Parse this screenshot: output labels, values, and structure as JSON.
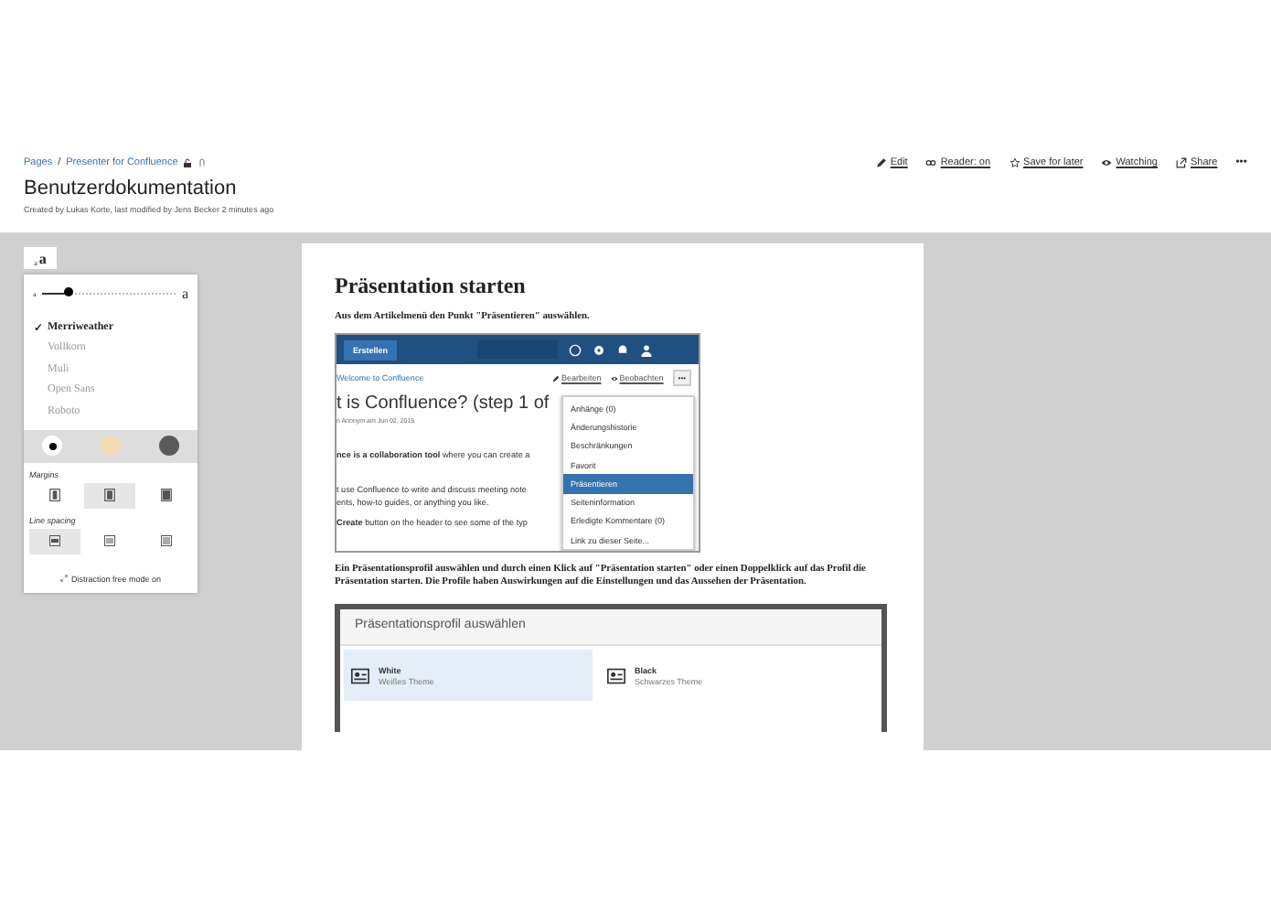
{
  "breadcrumbs": [
    "Pages",
    "Presenter for Confluence"
  ],
  "breadcrumb_separator": "/",
  "more_actions": "•••",
  "page_actions": [
    {
      "kind": "edit",
      "label": "Edit"
    },
    {
      "kind": "reader",
      "label": "Reader: on"
    },
    {
      "kind": "star",
      "label": "Save for later"
    },
    {
      "kind": "eye",
      "label": "Watching"
    },
    {
      "kind": "share",
      "label": "Share"
    }
  ],
  "title": "Benutzerdokumentation",
  "byline": "Created by Lukas Korte, last modified by Jens Becker 2 minutes ago",
  "reader_panel": {
    "size_toggle": [
      "a",
      "a"
    ],
    "size_slider": {
      "min_label": "a",
      "max_label": "a",
      "level": 0.2
    },
    "fonts": [
      {
        "label": "Merriweather",
        "selected": true
      },
      {
        "label": "Vollkorn",
        "selected": false
      },
      {
        "label": "Muli",
        "selected": false
      },
      {
        "label": "Open Sans",
        "selected": false
      },
      {
        "label": "Roboto",
        "selected": false
      }
    ],
    "check_mark": "✓",
    "themes": [
      {
        "color": "#ffffff",
        "selected": true
      },
      {
        "color": "#f0dcb0",
        "selected": false
      },
      {
        "color": "#5a5a5a",
        "selected": false
      }
    ],
    "margins": {
      "label": "Margins",
      "options": [
        {
          "selected": false
        },
        {
          "selected": true
        },
        {
          "selected": false
        }
      ]
    },
    "line_spacing": {
      "label": "Line spacing",
      "options": [
        {
          "selected": true
        },
        {
          "selected": false
        },
        {
          "selected": false
        }
      ]
    },
    "distraction_free": "Distraction free mode on"
  },
  "article": {
    "heading": "Präsentation starten",
    "intro": "Aus dem Artikelmenü den Punkt \"Präsentieren\" auswählen.",
    "screenshot_menu": {
      "create_button": "Erstellen",
      "breadcrumb": "Welcome to Confluence",
      "edit": "Bearbeiten",
      "watch": "Beobachten",
      "more": "•••",
      "page_title": "t is Confluence? (step 1 of",
      "byline": "n Anonym am Jun 02, 2015",
      "lines": [
        "**nce is a collaboration tool** where you can create a",
        "t use Confluence to write and discuss meeting note",
        "ents, how-to guides, or anything you like.",
        "**Create** button on the header to see some of the typ"
      ],
      "menu": [
        {
          "label": "Anhänge (0)",
          "selected": false
        },
        {
          "label": "Änderungshistorie",
          "selected": false
        },
        {
          "label": "Beschränkungen",
          "selected": false
        },
        {
          "label": "Favorit",
          "selected": false
        },
        {
          "label": "Präsentieren",
          "selected": true
        },
        {
          "label": "Seiteninformation",
          "selected": false
        },
        {
          "label": "Erledigte Kommentare (0)",
          "selected": false
        },
        {
          "label": "Link zu dieser Seite...",
          "selected": false
        }
      ]
    },
    "explanation": "Ein Präsentationsprofil auswählen und durch einen Klick auf \"Präsentation starten\" oder einen Doppelklick auf das Profil die Präsentation starten. Die Profile haben Auswirkungen auf die Einstellungen und das Aussehen der Präsentation.",
    "screenshot_profiles": {
      "title": "Präsentationsprofil auswählen",
      "profiles": [
        {
          "name": "White",
          "description": "Weißes Theme",
          "selected": true
        },
        {
          "name": "Black",
          "description": "Schwarzes Theme",
          "selected": false
        }
      ]
    }
  }
}
